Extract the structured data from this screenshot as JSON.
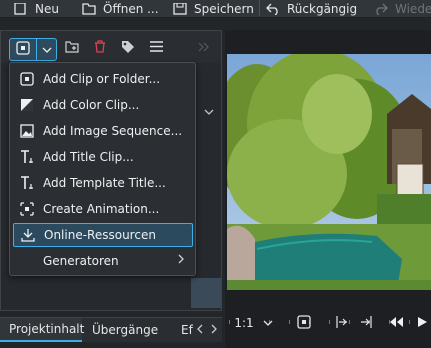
{
  "toolbar": {
    "new_label": "Neu",
    "open_label": "Öffnen ...",
    "save_label": "Speichern",
    "undo_label": "Rückgängig",
    "redo_label": "Wiede"
  },
  "menu": {
    "items": [
      {
        "label": "Add Clip or Folder...",
        "icon": "clip-icon"
      },
      {
        "label": "Add Color Clip...",
        "icon": "color-clip-icon"
      },
      {
        "label": "Add Image Sequence...",
        "icon": "image-sequence-icon"
      },
      {
        "label": "Add Title Clip...",
        "icon": "title-icon"
      },
      {
        "label": "Add Template Title...",
        "icon": "template-title-icon"
      },
      {
        "label": "Create Animation...",
        "icon": "animation-icon"
      },
      {
        "label": "Online-Ressourcen",
        "icon": "download-icon",
        "highlighted": true
      },
      {
        "label": "Generatoren",
        "icon": "none",
        "submenu": true
      }
    ]
  },
  "tabs": {
    "items": [
      {
        "label": "Projektinhalt",
        "active": true
      },
      {
        "label": "Übergänge",
        "active": false
      },
      {
        "label": "Ef",
        "active": false
      }
    ]
  },
  "monitor": {
    "zoom_label": "1:1"
  },
  "colors": {
    "accent": "#3daee9",
    "background": "#232629",
    "panel": "#2a2e32",
    "delete_red": "#da4453"
  }
}
